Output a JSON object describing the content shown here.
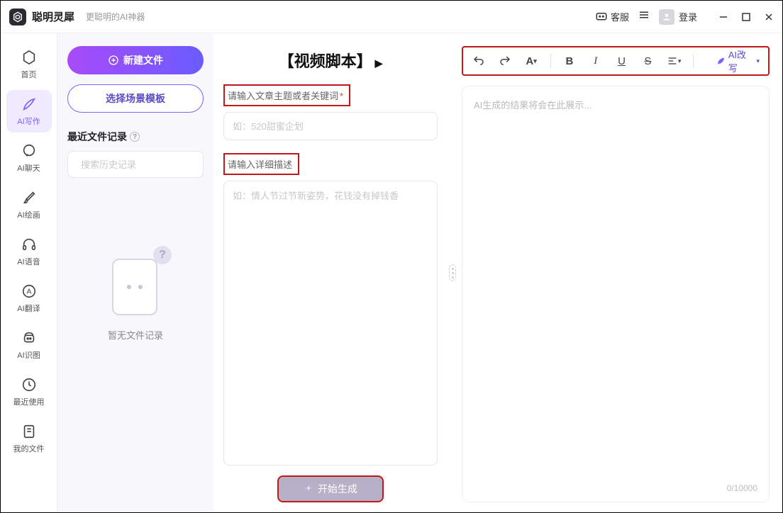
{
  "app": {
    "title": "聪明灵犀",
    "subtitle": "更聪明的AI神器"
  },
  "titlebar": {
    "kefu": "客服",
    "login": "登录"
  },
  "sidebar": {
    "items": [
      {
        "id": "home",
        "label": "首页"
      },
      {
        "id": "write",
        "label": "AI写作"
      },
      {
        "id": "chat",
        "label": "AI聊天"
      },
      {
        "id": "paint",
        "label": "AI绘画"
      },
      {
        "id": "voice",
        "label": "AI语音"
      },
      {
        "id": "translate",
        "label": "AI翻译"
      },
      {
        "id": "ocr",
        "label": "AI识图"
      },
      {
        "id": "recent",
        "label": "最近使用"
      },
      {
        "id": "myfiles",
        "label": "我的文件"
      }
    ]
  },
  "panel": {
    "new_file": "新建文件",
    "select_template": "选择场景模板",
    "recent_title": "最近文件记录",
    "search_placeholder": "搜索历史记录",
    "empty_text": "暂无文件记录"
  },
  "editor": {
    "title": "【视频脚本】",
    "label_topic": "请输入文章主题或者关键词",
    "placeholder_topic": "如：520甜蜜企划",
    "label_detail": "请输入详细描述",
    "placeholder_detail": "如：情人节过节新姿势，花钱没有掉钱香",
    "generate": "开始生成"
  },
  "output": {
    "ai_rewrite": "AI改写",
    "placeholder": "AI生成的结果将会在此展示...",
    "char_count": "0/10000"
  }
}
